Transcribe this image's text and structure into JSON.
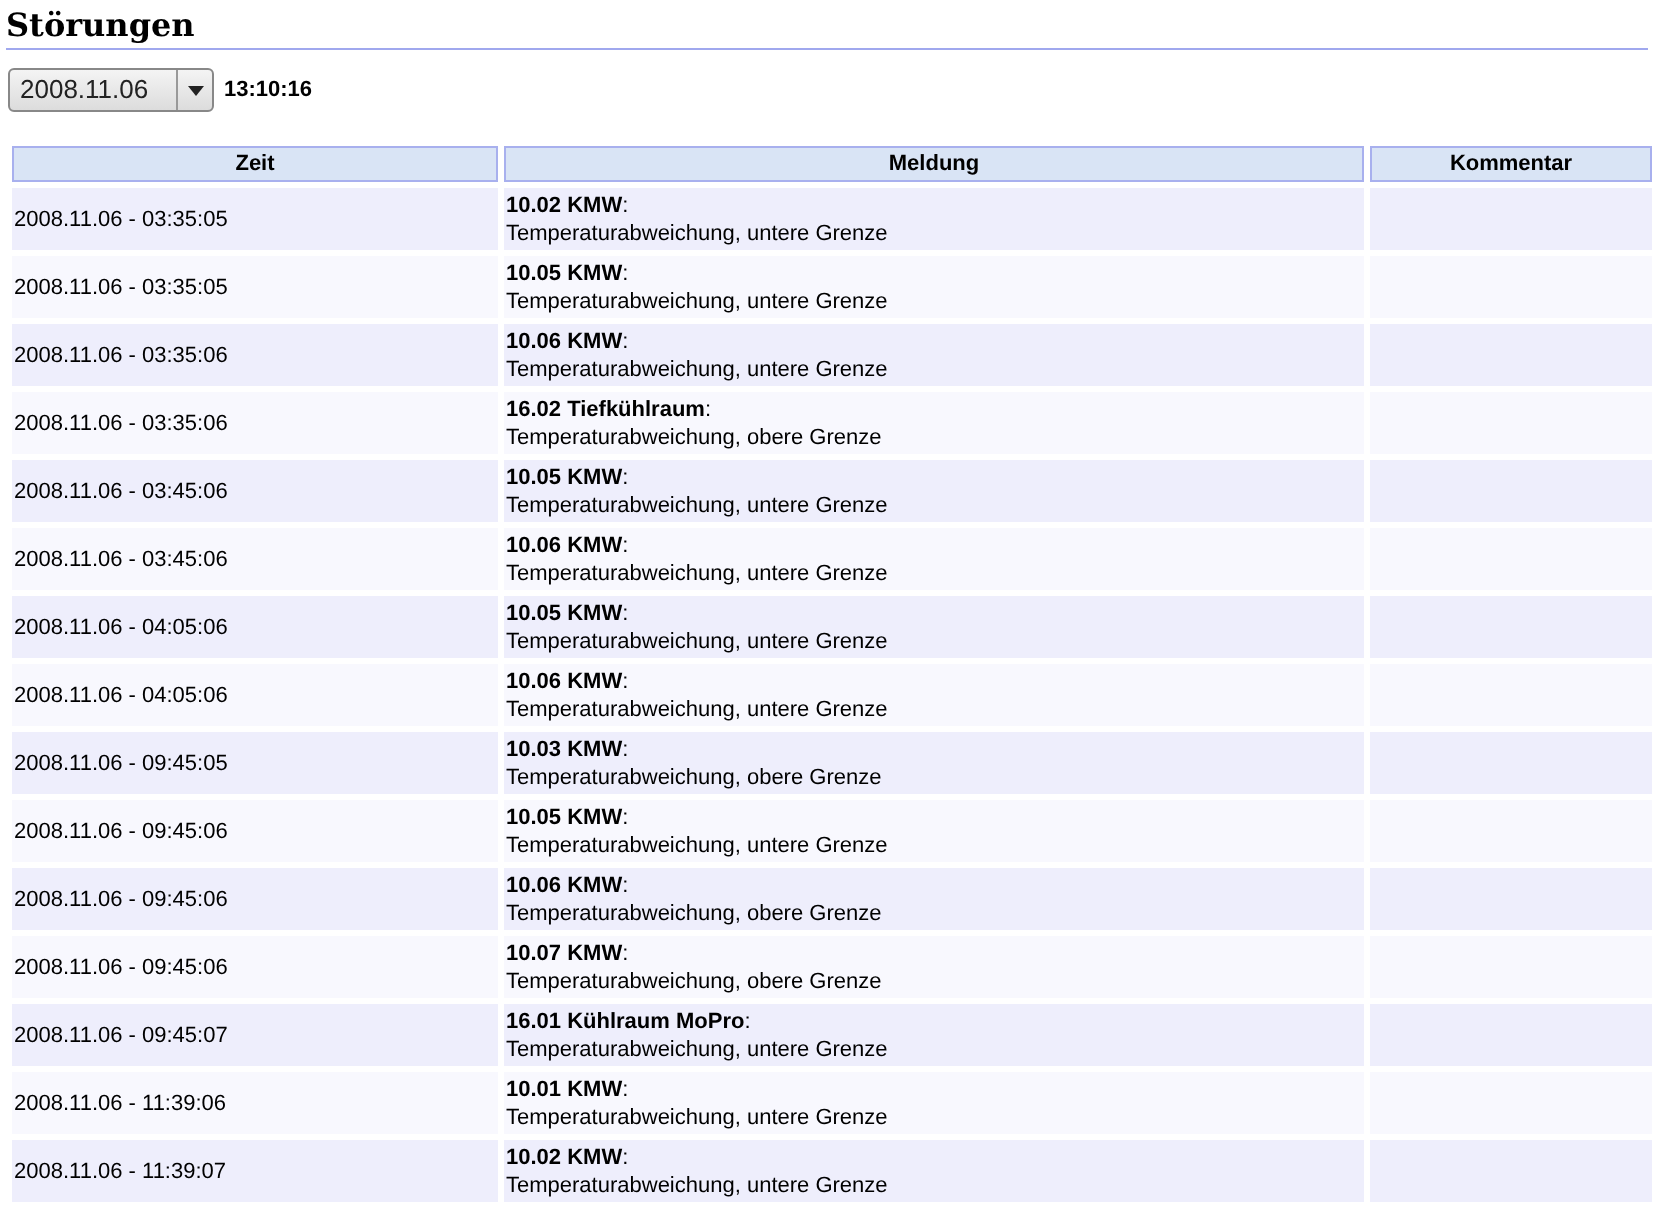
{
  "title": "Störungen",
  "date_select": {
    "value": "2008.11.06"
  },
  "time": "13:10:16",
  "table": {
    "columns": [
      "Zeit",
      "Meldung",
      "Kommentar"
    ],
    "rows": [
      {
        "time": "2008.11.06 - 03:35:05",
        "source": "**10.02 KMW**:",
        "message": "Temperaturabweichung, untere Grenze"
      },
      {
        "time": "2008.11.06 - 03:35:05",
        "source": "**10.05 KMW**:",
        "message": "Temperaturabweichung, untere Grenze"
      },
      {
        "time": "2008.11.06 - 03:35:06",
        "source": "**10.06 KMW**:",
        "message": "Temperaturabweichung, untere Grenze"
      },
      {
        "time": "2008.11.06 - 03:35:06",
        "source": "**16.02 Tiefkühlraum**:",
        "message": "Temperaturabweichung, obere Grenze"
      },
      {
        "time": "2008.11.06 - 03:45:06",
        "source": "**10.05 KMW**:",
        "message": "Temperaturabweichung, untere Grenze"
      },
      {
        "time": "2008.11.06 - 03:45:06",
        "source": "**10.06 KMW**:",
        "message": "Temperaturabweichung, untere Grenze"
      },
      {
        "time": "2008.11.06 - 04:05:06",
        "source": "**10.05 KMW**:",
        "message": "Temperaturabweichung, untere Grenze"
      },
      {
        "time": "2008.11.06 - 04:05:06",
        "source": "**10.06 KMW**:",
        "message": "Temperaturabweichung, untere Grenze"
      },
      {
        "time": "2008.11.06 - 09:45:05",
        "source": "**10.03 KMW**:",
        "message": "Temperaturabweichung, obere Grenze"
      },
      {
        "time": "2008.11.06 - 09:45:06",
        "source": "**10.05 KMW**:",
        "message": "Temperaturabweichung, untere Grenze"
      },
      {
        "time": "2008.11.06 - 09:45:06",
        "source": "**10.06 KMW**:",
        "message": "Temperaturabweichung, obere Grenze"
      },
      {
        "time": "2008.11.06 - 09:45:06",
        "source": "**10.07 KMW**:",
        "message": "Temperaturabweichung, obere Grenze"
      },
      {
        "time": "2008.11.06 - 09:45:07",
        "source": "**16.01 Kühlraum MoPro**:",
        "message": "Temperaturabweichung, untere Grenze"
      },
      {
        "time": "2008.11.06 - 11:39:06",
        "source": "**10.01 KMW**:",
        "message": "Temperaturabweichung, untere Grenze"
      },
      {
        "time": "2008.11.06 - 11:39:07",
        "source": "**10.02 KMW**:",
        "message": "Temperaturabweichung, untere Grenze"
      }
    ]
  }
}
